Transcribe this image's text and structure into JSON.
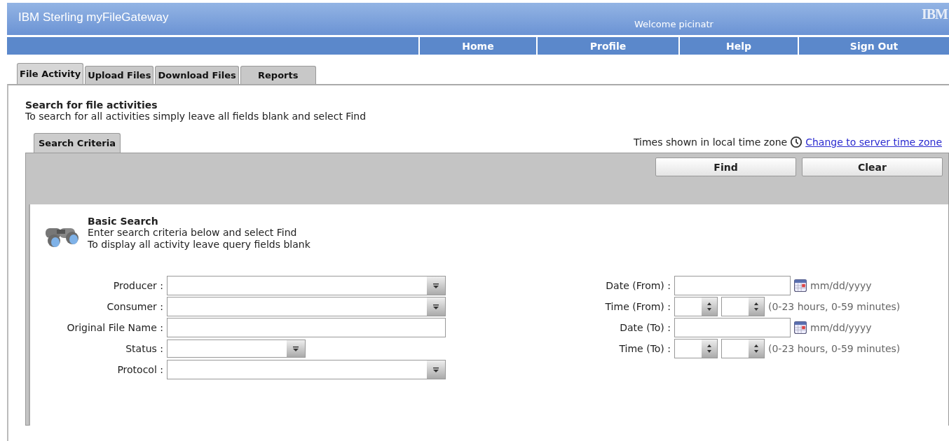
{
  "header": {
    "title": "IBM Sterling myFileGateway",
    "welcome": "Welcome picinatr",
    "logo": "IBM"
  },
  "nav": [
    {
      "label": "Home"
    },
    {
      "label": "Profile"
    },
    {
      "label": "Help"
    },
    {
      "label": "Sign Out"
    }
  ],
  "tabs": [
    {
      "label": "File Activity",
      "selected": true
    },
    {
      "label": "Upload Files",
      "selected": false
    },
    {
      "label": "Download Files",
      "selected": false
    },
    {
      "label": "Reports",
      "selected": false
    }
  ],
  "page": {
    "heading": "Search for file activities",
    "subheading": "To search for all activities simply leave all fields blank and select Find"
  },
  "subtab": {
    "label": "Search Criteria",
    "selected": true
  },
  "timezone": {
    "text": "Times shown in local time zone",
    "link": "Change to server time zone"
  },
  "buttons": [
    "Find",
    "Clear"
  ],
  "basic_search": {
    "title": "Basic Search",
    "lines": [
      "Enter search criteria below and select Find",
      "To display all activity leave query fields blank"
    ]
  },
  "left_fields": [
    {
      "label": "Producer :",
      "kind": "combo"
    },
    {
      "label": "Consumer :",
      "kind": "combo"
    },
    {
      "label": "Original File Name :",
      "kind": "text"
    },
    {
      "label": "Status :",
      "kind": "short-combo"
    },
    {
      "label": "Protocol :",
      "kind": "combo"
    }
  ],
  "right_fields": [
    {
      "label": "Date (From) :",
      "kind": "date",
      "hint": "mm/dd/yyyy"
    },
    {
      "label": "Time (From) :",
      "kind": "time",
      "hint": "(0-23 hours, 0-59 minutes)"
    },
    {
      "label": "Date (To) :",
      "kind": "date",
      "hint": "mm/dd/yyyy"
    },
    {
      "label": "Time (To) :",
      "kind": "time",
      "hint": "(0-23 hours, 0-59 minutes)"
    }
  ]
}
